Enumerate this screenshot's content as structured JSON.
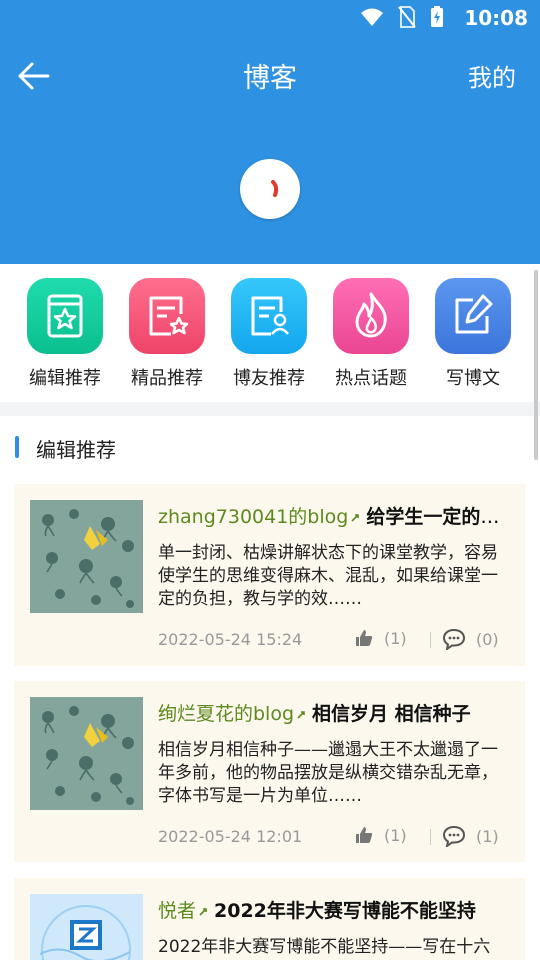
{
  "status": {
    "time": "10:08"
  },
  "header": {
    "title": "博客",
    "mine_label": "我的"
  },
  "categories": [
    {
      "label": "编辑推荐",
      "icon": "book-star-icon",
      "color": "#12c998"
    },
    {
      "label": "精品推荐",
      "icon": "doc-star-icon",
      "color": "#f4567a"
    },
    {
      "label": "博友推荐",
      "icon": "contact-card-icon",
      "color": "#1fb8f2"
    },
    {
      "label": "热点话题",
      "icon": "flame-icon",
      "color": "#f45fa6"
    },
    {
      "label": "写博文",
      "icon": "edit-icon",
      "color": "#4c86e6"
    }
  ],
  "section": {
    "title": "编辑推荐"
  },
  "posts": [
    {
      "author": "zhang730041的blog",
      "title": "给学生一定的负担",
      "excerpt": "单一封闭、枯燥讲解状态下的课堂教学，容易使学生的思维变得麻木、混乱，如果给课堂一定的负担，教与学的效……",
      "date": "2022-05-24 15:24",
      "likes": "(1)",
      "comments": "(0)"
    },
    {
      "author": "绚烂夏花的blog",
      "title": "相信岁月  相信种子",
      "excerpt": "相信岁月相信种子——邋遢大王不太邋遢了一年多前，他的物品摆放是纵横交错杂乱无章，字体书写是一片为单位……",
      "date": "2022-05-24 12:01",
      "likes": "(1)",
      "comments": "(1)"
    },
    {
      "author": "悦者",
      "title": "2022年非大赛写博能不能坚持",
      "excerpt": "2022年非大赛写博能不能坚持——写在十六",
      "date": "",
      "likes": "",
      "comments": ""
    }
  ]
}
